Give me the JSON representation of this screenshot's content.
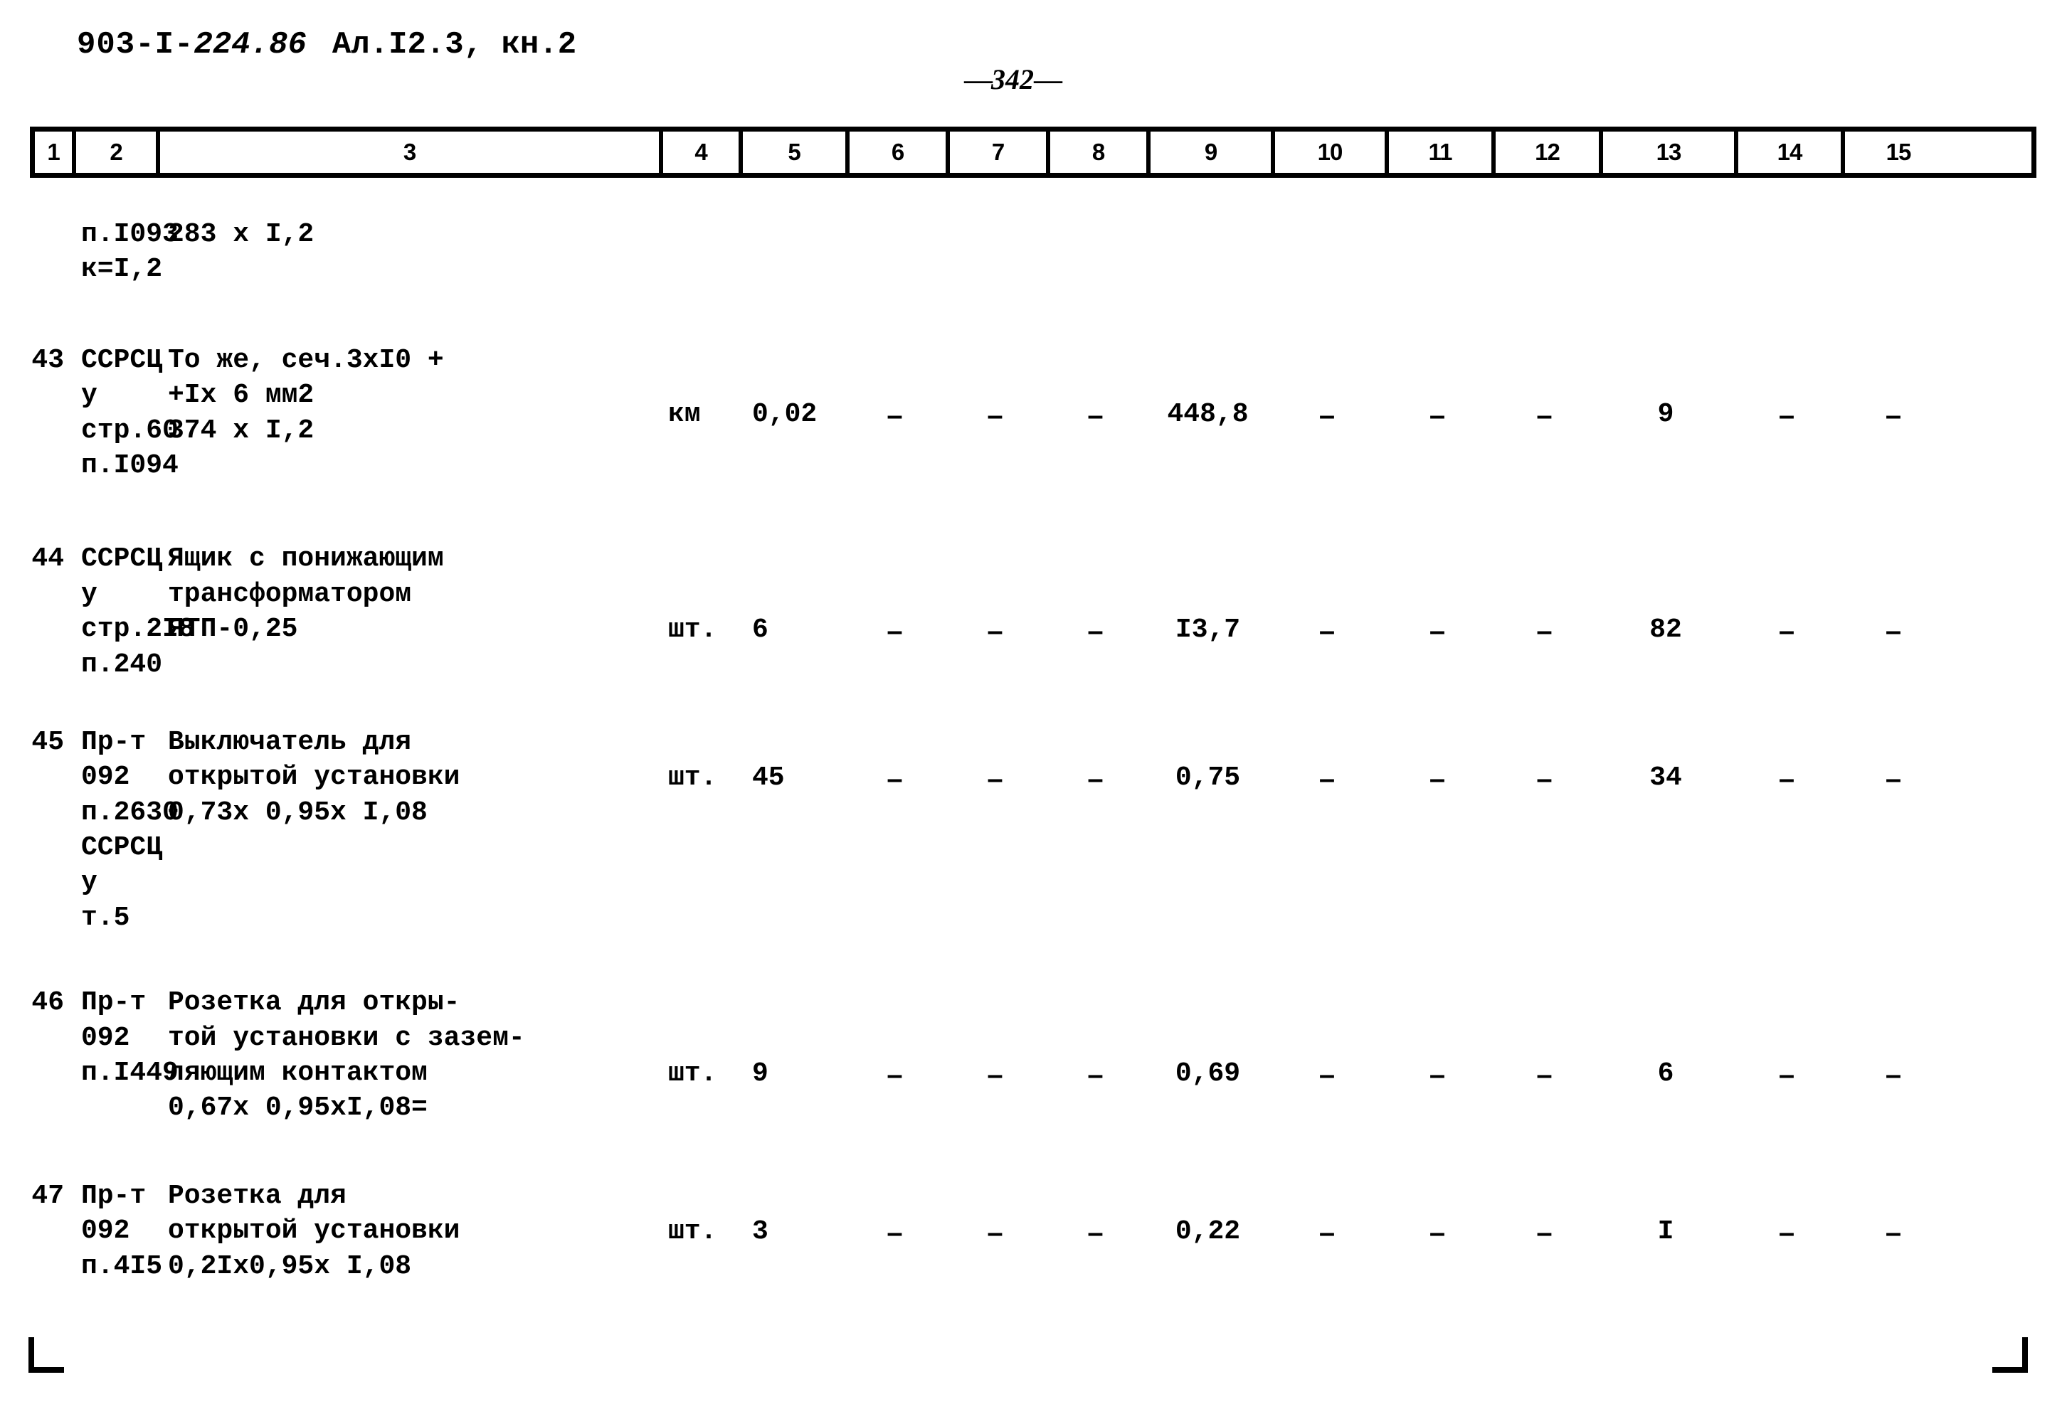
{
  "header": {
    "doc_code_plain": "903-I-",
    "doc_code_em": "224.86",
    "album": "Ал.I2.3, кн.2",
    "page_number": "342",
    "page_dash_left": "—",
    "page_dash_right": "—"
  },
  "table": {
    "column_headers": [
      "1",
      "2",
      "3",
      "4",
      "5",
      "6",
      "7",
      "8",
      "9",
      "10",
      "11",
      "12",
      "13",
      "14",
      "15"
    ],
    "rows": [
      {
        "num": "",
        "justification": "п.I093\nк=I,2",
        "description": "283 x I,2",
        "unit": "",
        "c5": "",
        "c6": "",
        "c7": "",
        "c8": "",
        "c9": "",
        "c10": "",
        "c11": "",
        "c12": "",
        "c13": "",
        "c14": "",
        "c15": ""
      },
      {
        "num": "43",
        "justification": "ССРСЦ\nу\nстр.60\nп.I094",
        "description": "То же, сеч.3xI0 +\n   +Ix 6 мм2\n   374 x I,2",
        "unit": "км",
        "c5": "0,02",
        "c6": "–",
        "c7": "–",
        "c8": "–",
        "c9": "448,8",
        "c10": "–",
        "c11": "–",
        "c12": "–",
        "c13": "9",
        "c14": "–",
        "c15": "–"
      },
      {
        "num": "44",
        "justification": "ССРСЦ\nу\nстр.2I8\nп.240",
        "description": "Ящик с понижающим\nтрансформатором\nЯТП-0,25",
        "unit": "шт.",
        "c5": "6",
        "c6": "–",
        "c7": "–",
        "c8": "–",
        "c9": "I3,7",
        "c10": "–",
        "c11": "–",
        "c12": "–",
        "c13": "82",
        "c14": "–",
        "c15": "–"
      },
      {
        "num": "45",
        "justification": "Пр-т\n092\nп.2630\nССРСЦ\nу\nт.5",
        "description": "Выключатель для\nоткрытой установки\n  0,73x 0,95x I,08",
        "unit": "шт.",
        "c5": "45",
        "c6": "–",
        "c7": "–",
        "c8": "–",
        "c9": "0,75",
        "c10": "–",
        "c11": "–",
        "c12": "–",
        "c13": "34",
        "c14": "–",
        "c15": "–"
      },
      {
        "num": "46",
        "justification": "Пр-т\n092\nп.I449",
        "description": "Розетка для откры-\nтой установки с зазем-\nляющим контактом\n   0,67x 0,95xI,08=",
        "unit": "шт.",
        "c5": "9",
        "c6": "–",
        "c7": "–",
        "c8": "–",
        "c9": "0,69",
        "c10": "–",
        "c11": "–",
        "c12": "–",
        "c13": "6",
        "c14": "–",
        "c15": "–"
      },
      {
        "num": "47",
        "justification": "Пр-т\n092\nп.4I5",
        "description": "Розетка для\nоткрытой установки\n  0,2Ix0,95x I,08",
        "unit": "шт.",
        "c5": "3",
        "c6": "–",
        "c7": "–",
        "c8": "–",
        "c9": "0,22",
        "c10": "–",
        "c11": "–",
        "c12": "–",
        "c13": "I",
        "c14": "–",
        "c15": "–"
      }
    ]
  }
}
